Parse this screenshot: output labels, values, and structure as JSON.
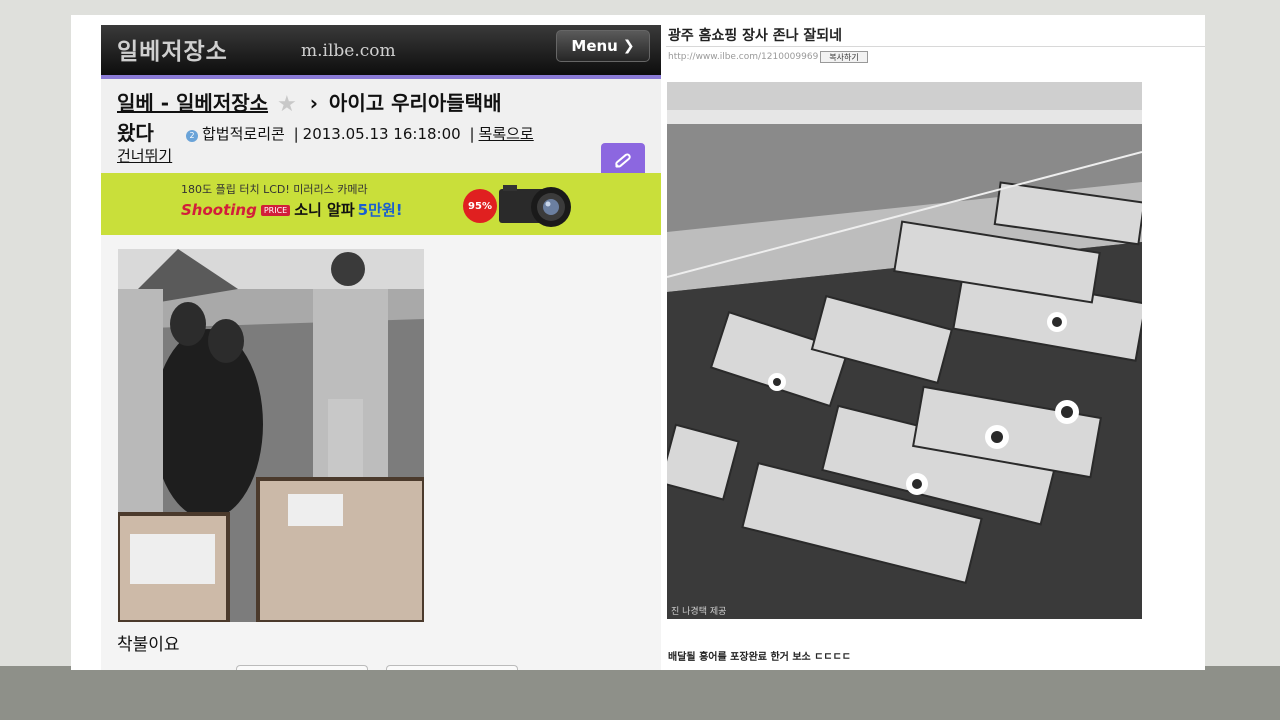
{
  "site": {
    "name": "일베저장소",
    "domain": "m.ilbe.com",
    "menu_label": "Menu"
  },
  "post": {
    "breadcrumb_board": "일베 - 일베저장소",
    "breadcrumb_sep": "›",
    "title_part1": "아이고 우리아들택배",
    "title_part2": "왔다",
    "author": "합법적로리콘",
    "date": "2013.05.13 16:18:00",
    "list_link": "목록으로",
    "skip_link": "건너뛰기",
    "meta_sep": "|",
    "caption": "착불이요"
  },
  "ad": {
    "line1": "180도 플립 터치 LCD! 미러리스 카메라",
    "brand": "Shooting",
    "tag": "PRICE",
    "product": "소니 알파",
    "price": "5만원!",
    "badge": "95%"
  },
  "blog": {
    "title": "광주 홈쇼핑 장사 존나 잘되네",
    "url": "http://www.ilbe.com/1210009969",
    "copy_label": "복사하기",
    "photo_credit": "진 나경택 제공",
    "body": "배달될 홍어를 포장완료 한거 보소 ㄷㄷㄷㄷ"
  },
  "icons": {
    "favorite": "star-icon",
    "edit": "pencil-icon",
    "menu_arrow": "chevron-right-icon",
    "level": "level-badge-icon"
  },
  "colors": {
    "header_accent": "#8a7ad6",
    "edit_button": "#8c67e0",
    "ad_background": "#c9df3a",
    "ad_brand": "#d21e3a"
  }
}
